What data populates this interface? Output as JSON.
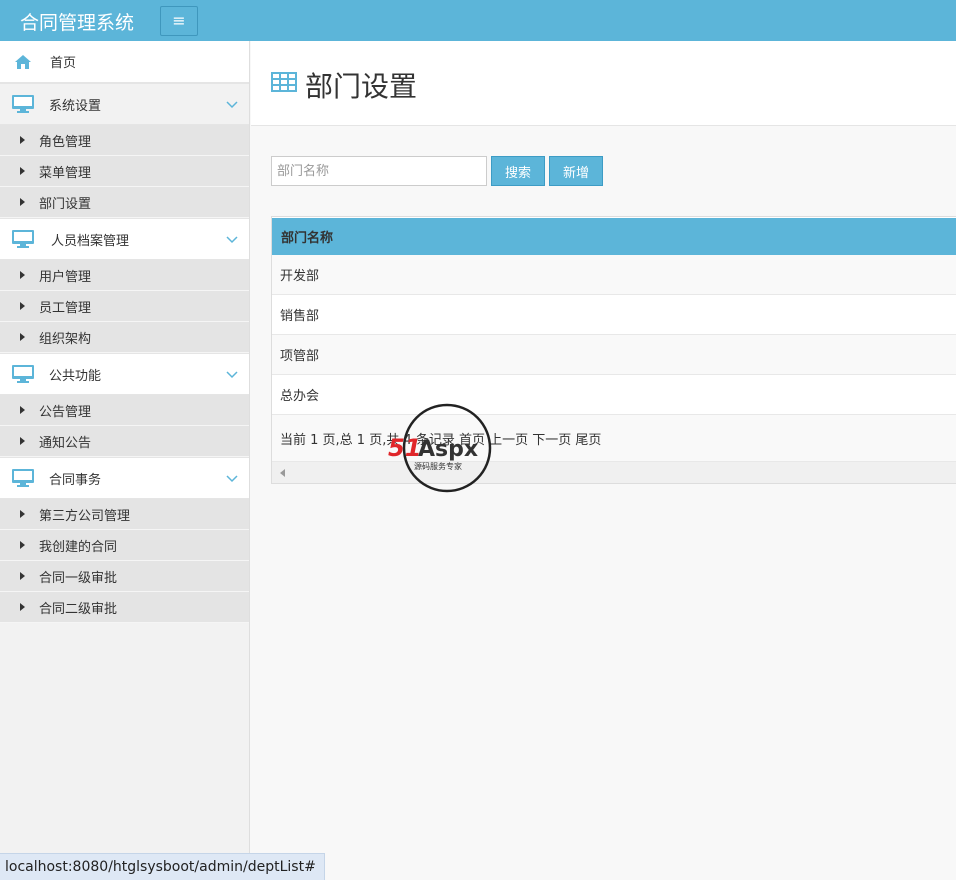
{
  "app": {
    "title": "合同管理系统",
    "menu_toggle_icon": "bars-icon"
  },
  "sidebar": {
    "home": {
      "label": "首页",
      "icon": "home-icon"
    },
    "groups": [
      {
        "label": "系统设置",
        "icon": "monitor-icon",
        "items": [
          "角色管理",
          "菜单管理",
          "部门设置"
        ]
      },
      {
        "label": "人员档案管理",
        "icon": "monitor-icon",
        "items": [
          "用户管理",
          "员工管理",
          "组织架构"
        ]
      },
      {
        "label": "公共功能",
        "icon": "monitor-icon",
        "items": [
          "公告管理",
          "通知公告"
        ]
      },
      {
        "label": "合同事务",
        "icon": "monitor-icon",
        "items": [
          "第三方公司管理",
          "我创建的合同",
          "合同一级审批",
          "合同二级审批"
        ]
      }
    ]
  },
  "main": {
    "title": "部门设置",
    "search": {
      "placeholder": "部门名称",
      "value": ""
    },
    "buttons": {
      "search": "搜索",
      "add": "新增"
    },
    "table": {
      "header": "部门名称",
      "rows": [
        "开发部",
        "销售部",
        "项管部",
        "总办会"
      ]
    },
    "pager": "当前 1 页,总 1 页,共 4 条记录 首页 上一页 下一页 尾页"
  },
  "watermark": {
    "brand_red": "51",
    "brand_dark": "Aspx",
    "subtitle": "源码服务专家"
  },
  "statusbar": {
    "url": "localhost:8080/htglsysboot/admin/deptList#"
  },
  "colors": {
    "accent": "#5cb5d9",
    "sidebar_bg": "#f2f2f2",
    "submenu_bg": "#e4e4e4"
  }
}
